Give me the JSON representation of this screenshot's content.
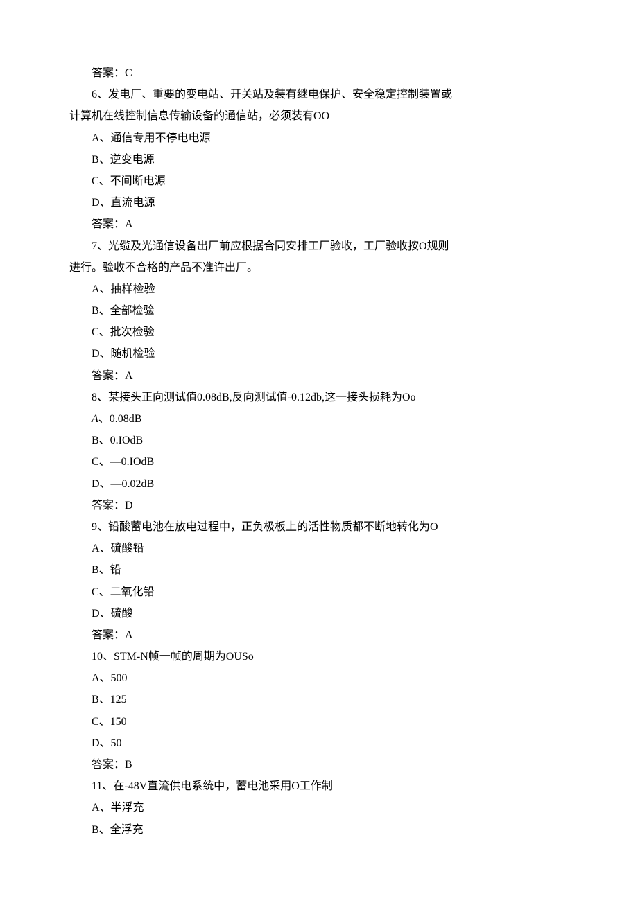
{
  "lines": [
    {
      "text": "答案：C",
      "indent": true
    },
    {
      "text": "6、发电厂、重要的变电站、开关站及装有继电保护、安全稳定控制装置或",
      "indent": true
    },
    {
      "text": "计算机在线控制信息传输设备的通信站，必须装有OO",
      "indent": false
    },
    {
      "text": "A、通信专用不停电电源",
      "indent": true
    },
    {
      "text": "B、逆变电源",
      "indent": true
    },
    {
      "text": "C、不间断电源",
      "indent": true
    },
    {
      "text": "D、直流电源",
      "indent": true
    },
    {
      "text": "答案：A",
      "indent": true
    },
    {
      "text": "7、光缆及光通信设备出厂前应根据合同安排工厂验收，工厂验收按O规则",
      "indent": true
    },
    {
      "text": "进行。验收不合格的产品不准许出厂。",
      "indent": false
    },
    {
      "text": "A、抽样检验",
      "indent": true
    },
    {
      "text": "B、全部检验",
      "indent": true
    },
    {
      "text": "C、批次检验",
      "indent": true
    },
    {
      "text": "D、随机检验",
      "indent": true
    },
    {
      "text": "答案：A",
      "indent": true
    },
    {
      "text": "8、某接头正向测试值0.08dB,反向测试值-0.12db,这一接头损耗为Oo",
      "indent": true
    },
    {
      "text": "A、0.08dB",
      "indent": true,
      "italicA": true
    },
    {
      "text": "B、0.IOdB",
      "indent": true
    },
    {
      "text": "C、—0.IOdB",
      "indent": true
    },
    {
      "text": "D、—0.02dB",
      "indent": true
    },
    {
      "text": "答案：D",
      "indent": true
    },
    {
      "text": "9、铅酸蓄电池在放电过程中，正负极板上的活性物质都不断地转化为O",
      "indent": true
    },
    {
      "text": "A、硫酸铅",
      "indent": true
    },
    {
      "text": "B、铅",
      "indent": true
    },
    {
      "text": "C、二氧化铅",
      "indent": true
    },
    {
      "text": "D、硫酸",
      "indent": true
    },
    {
      "text": "答案：A",
      "indent": true
    },
    {
      "text": "10、STM-N帧一帧的周期为OUSo",
      "indent": true
    },
    {
      "text": "A、500",
      "indent": true
    },
    {
      "text": "B、125",
      "indent": true
    },
    {
      "text": "C、150",
      "indent": true
    },
    {
      "text": "D、50",
      "indent": true
    },
    {
      "text": "答案：B",
      "indent": true
    },
    {
      "text": "11、在-48V直流供电系统中，蓄电池采用O工作制",
      "indent": true
    },
    {
      "text": "A、半浮充",
      "indent": true
    },
    {
      "text": "B、全浮充",
      "indent": true
    }
  ]
}
